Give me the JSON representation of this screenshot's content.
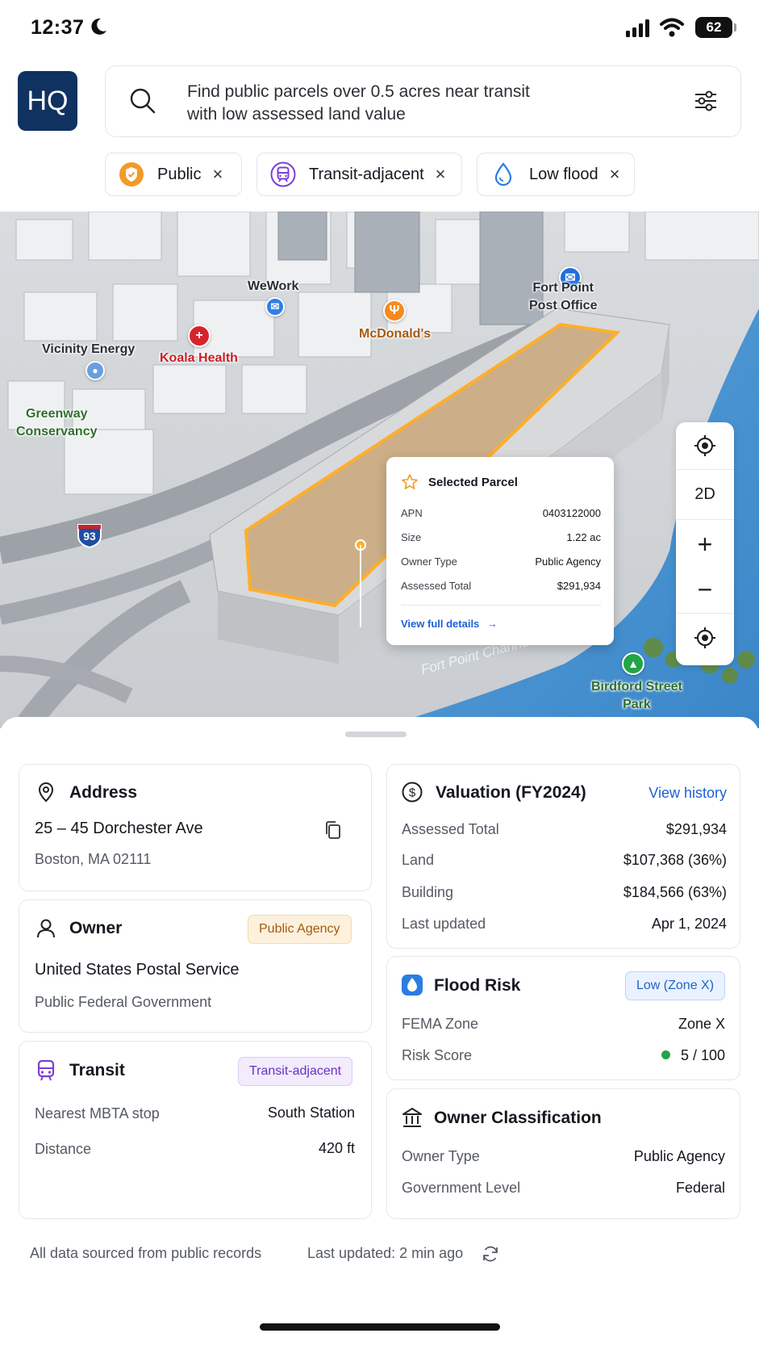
{
  "status_bar": {
    "time": "12:37",
    "battery": "62"
  },
  "header": {
    "logo_text": "HQ",
    "search_line1": "Find public parcels over 0.5 acres near transit",
    "search_line2": "with low assessed land value"
  },
  "chips": [
    {
      "label": "Public",
      "icon": "shield-icon",
      "color": "#f39a27"
    },
    {
      "label": "Transit-adjacent",
      "icon": "train-icon",
      "color": "#7b3fd6"
    },
    {
      "label": "Low flood",
      "icon": "droplet-icon",
      "color": "#2a7de1"
    }
  ],
  "map": {
    "pois": [
      {
        "label": "WeWork"
      },
      {
        "label": "Fort Point\nPost Office"
      },
      {
        "label": "McDonald's"
      },
      {
        "label": "Vicinity Energy"
      },
      {
        "label": "Koala Health"
      },
      {
        "label": "Greenway\nConservancy"
      },
      {
        "label": "Birdford Street\nPark"
      }
    ],
    "highway_shield": "93",
    "water_label": "Fort Point Channel",
    "controls": {
      "mode": "2D",
      "zoom_in": "+",
      "zoom_out": "−"
    }
  },
  "parcel_card": {
    "title": "Selected Parcel",
    "rows": [
      {
        "k": "APN",
        "v": "0403122000"
      },
      {
        "k": "Size",
        "v": "1.22 ac"
      },
      {
        "k": "Owner Type",
        "v": "Public Agency"
      },
      {
        "k": "Assessed Total",
        "v": "$291,934"
      }
    ],
    "link": "View full details"
  },
  "address": {
    "title": "Address",
    "line1": "25 – 45 Dorchester Ave",
    "line2": "Boston, MA 02111"
  },
  "owner": {
    "title": "Owner",
    "badge": "Public Agency",
    "name": "United States Postal Service",
    "type": "Public Federal Government"
  },
  "transit": {
    "title": "Transit",
    "badge": "Transit-adjacent",
    "rows": [
      {
        "k": "Nearest MBTA stop",
        "v": "South Station"
      },
      {
        "k": "Distance",
        "v": "420 ft"
      }
    ]
  },
  "valuation": {
    "title": "Valuation (FY2024)",
    "link": "View history",
    "rows": [
      {
        "k": "Assessed Total",
        "v": "$291,934"
      },
      {
        "k": "Land",
        "v": "$107,368 (36%)"
      },
      {
        "k": "Building",
        "v": "$184,566 (63%)"
      },
      {
        "k": "Last updated",
        "v": "Apr 1, 2024"
      }
    ]
  },
  "flood": {
    "title": "Flood Risk",
    "badge": "Low (Zone X)",
    "rows": [
      {
        "k": "FEMA Zone",
        "v": "Zone X"
      },
      {
        "k": "Risk Score",
        "v": "5 / 100"
      }
    ],
    "score_dot_color": "#22a447"
  },
  "classification": {
    "title": "Owner Classification",
    "rows": [
      {
        "k": "Owner Type",
        "v": "Public Agency"
      },
      {
        "k": "Government Level",
        "v": "Federal"
      }
    ]
  },
  "footer": {
    "source": "All data sourced from public records",
    "updated": "Last updated: 2 min ago"
  }
}
